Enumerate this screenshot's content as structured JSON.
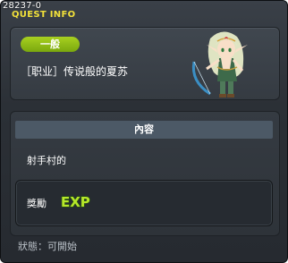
{
  "window": {
    "quest_id": "28237-0",
    "title": "QUEST INFO"
  },
  "quest": {
    "category": "一般",
    "name": "［职业］传说般的夏苏",
    "npc_portrait": "elf-archer-npc-portrait"
  },
  "content": {
    "header": "內容",
    "text": "射手村的"
  },
  "reward": {
    "label": "獎勵",
    "icon": "exp-icon",
    "icon_text": "EXP",
    "icon_color": "#b6e62a"
  },
  "status": {
    "text": "狀態：可開始"
  },
  "colors": {
    "title": "#f2e13a",
    "badge": "#8dbb14",
    "panel": "#3b4249",
    "content_header": "#4c5966"
  }
}
